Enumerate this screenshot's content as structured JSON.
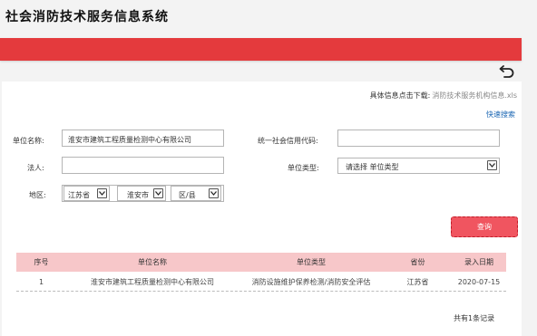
{
  "app": {
    "title": "社会消防技术服务信息系统"
  },
  "colors": {
    "header_band": "#e43a3d",
    "query_button": "#f05560",
    "table_header": "#f7c7c9",
    "link": "#1a66b3"
  },
  "toolbar": {
    "back_icon": "return-arrow-icon"
  },
  "download": {
    "prefix": "具体信息点击下载:",
    "link_text": "消防技术服务机构信息.xls"
  },
  "quick_search": "快速搜索",
  "form": {
    "unit_name": {
      "label": "单位名称:",
      "value": "淮安市建筑工程质量检测中心有限公司"
    },
    "credit_code": {
      "label": "统一社会信用代码:",
      "value": ""
    },
    "legal_person": {
      "label": "法人:",
      "value": ""
    },
    "unit_type": {
      "label": "单位类型:",
      "value": "请选择 单位类型"
    },
    "region": {
      "label": "地区:",
      "province": "江苏省",
      "city": "淮安市",
      "district": "区/县"
    }
  },
  "query_button": "查询",
  "table": {
    "headers": [
      "序号",
      "单位名称",
      "单位类型",
      "省份",
      "录入日期"
    ],
    "rows": [
      [
        "1",
        "淮安市建筑工程质量检测中心有限公司",
        "消防设施维护保养检测/消防安全评估",
        "江苏省",
        "2020-07-15"
      ]
    ]
  },
  "pagination": {
    "total": "共有1条记录"
  }
}
